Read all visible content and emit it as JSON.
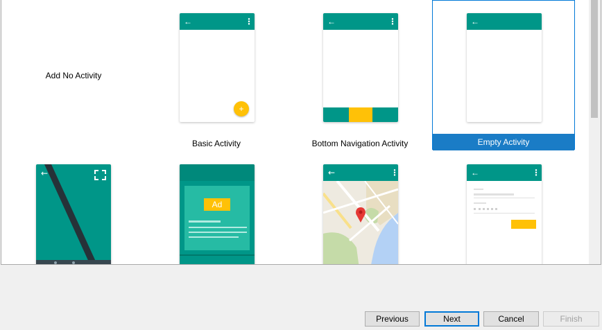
{
  "gallery": {
    "templates": [
      {
        "label": "Add No Activity"
      },
      {
        "label": "Basic Activity"
      },
      {
        "label": "Bottom Navigation Activity"
      },
      {
        "label": "Empty Activity",
        "selected": true
      },
      {
        "label": ""
      },
      {
        "label": ""
      },
      {
        "label": ""
      },
      {
        "label": ""
      }
    ],
    "ad_badge": "Ad"
  },
  "colors": {
    "app_bar": "#009688",
    "accent": "#ffc107",
    "selection": "#1a7cc6"
  },
  "icons": {
    "back": "←",
    "overflow": "⋮",
    "fab": "+"
  },
  "footer": {
    "previous_label": "Previous",
    "next_label": "Next",
    "cancel_label": "Cancel",
    "finish_label": "Finish"
  }
}
